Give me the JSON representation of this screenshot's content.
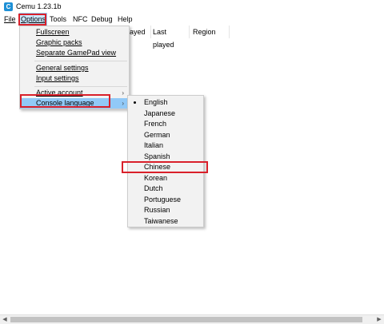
{
  "window": {
    "title": "Cemu 1.23.1b",
    "icon_letter": "C"
  },
  "menubar": {
    "items": [
      "File",
      "Options",
      "Tools",
      "NFC",
      "Debug",
      "Help"
    ]
  },
  "game_list": {
    "columns": [
      "layed",
      "Last played",
      "Region"
    ]
  },
  "options_menu": {
    "items": [
      "Fullscreen",
      "Graphic packs",
      "Separate GamePad view",
      "General settings",
      "Input settings",
      "Active account",
      "Console language"
    ],
    "highlighted": "Console language"
  },
  "language_menu": {
    "items": [
      "English",
      "Japanese",
      "French",
      "German",
      "Italian",
      "Spanish",
      "Chinese",
      "Korean",
      "Dutch",
      "Portuguese",
      "Russian",
      "Taiwanese"
    ],
    "selected": "English",
    "annotated": "Chinese"
  },
  "colors": {
    "highlight": "#91c9f7",
    "menu_background": "#f2f2f2",
    "annotation_red": "#d9202a",
    "icon_blue": "#1e90d6"
  },
  "icons": [
    "app-icon",
    "submenu-arrow-icon",
    "bullet-icon",
    "scroll-left-icon",
    "scroll-right-icon"
  ]
}
